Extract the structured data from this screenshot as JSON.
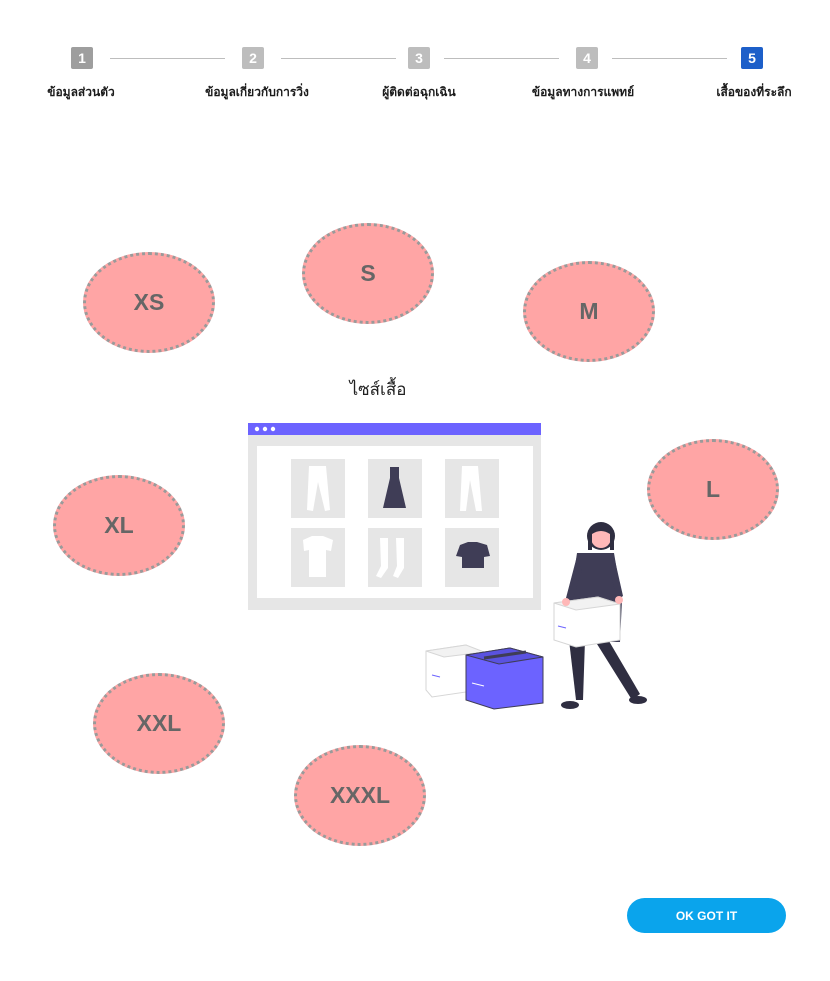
{
  "stepper": {
    "steps": [
      {
        "number": "1",
        "label": "ข้อมูลส่วนตัว",
        "state": "done",
        "color": "#9e9e9e"
      },
      {
        "number": "2",
        "label": "ข้อมูลเกี่ยวกับการวิ่ง",
        "state": "done",
        "color": "#bdbdbd"
      },
      {
        "number": "3",
        "label": "ผู้ติดต่อฉุกเฉิน",
        "state": "done",
        "color": "#bdbdbd"
      },
      {
        "number": "4",
        "label": "ข้อมูลทางการแพทย์",
        "state": "done",
        "color": "#bdbdbd"
      },
      {
        "number": "5",
        "label": "เสื้อของที่ระลึก",
        "state": "active",
        "color": "#1d5fc9"
      }
    ]
  },
  "title": "ไซส์เสื้อ",
  "sizes": [
    "XS",
    "S",
    "M",
    "L",
    "XL",
    "XXL",
    "XXXL"
  ],
  "illustration": {
    "name": "online-shopping-illustration",
    "accent_color": "#6c63ff",
    "panel_color": "#e6e6e6",
    "dark_color": "#3f3d56"
  },
  "colors": {
    "bubble_fill": "#ffa5a5",
    "bubble_border": "#9a9a9a",
    "button": "#0aa4ec"
  },
  "ok_button": {
    "label": "OK GOT IT"
  }
}
